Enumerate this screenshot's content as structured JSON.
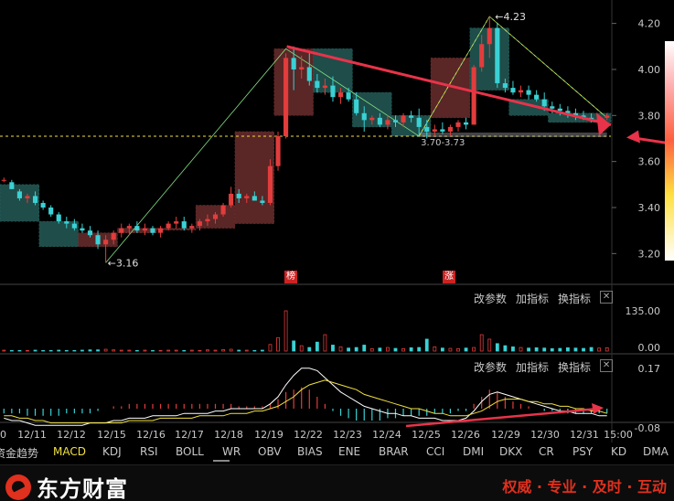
{
  "chart_data": {
    "type": "candlestick",
    "price_axis_ticks": [
      "4.20",
      "4.00",
      "3.80",
      "3.60",
      "3.40",
      "3.20"
    ],
    "price_range": [
      3.11,
      4.27
    ],
    "date_labels": [
      "0",
      "12/11",
      "12/12",
      "12/15",
      "12/16",
      "12/17",
      "12/18",
      "12/19",
      "12/22",
      "12/23",
      "12/24",
      "12/25",
      "12/26",
      "12/29",
      "12/30",
      "12/31",
      "15:00"
    ],
    "annotations": {
      "high": "4.23",
      "low": "3.16",
      "range": "3.70-3.73"
    },
    "badges": [
      "榜",
      "涨"
    ],
    "volume_axis_ticks": [
      "135.00",
      "0.00"
    ],
    "macd_axis_ticks": [
      "0.17",
      "-0.08"
    ],
    "candles": [
      [
        3.52,
        3.53,
        3.51,
        3.52
      ],
      [
        3.51,
        3.52,
        3.48,
        3.48
      ],
      [
        3.47,
        3.48,
        3.43,
        3.44
      ],
      [
        3.44,
        3.46,
        3.42,
        3.45
      ],
      [
        3.45,
        3.47,
        3.41,
        3.42
      ],
      [
        3.42,
        3.43,
        3.39,
        3.4
      ],
      [
        3.4,
        3.41,
        3.36,
        3.37
      ],
      [
        3.37,
        3.38,
        3.33,
        3.34
      ],
      [
        3.34,
        3.36,
        3.31,
        3.33
      ],
      [
        3.33,
        3.35,
        3.3,
        3.31
      ],
      [
        3.31,
        3.33,
        3.29,
        3.3
      ],
      [
        3.3,
        3.32,
        3.27,
        3.28
      ],
      [
        3.28,
        3.3,
        3.22,
        3.24
      ],
      [
        3.24,
        3.28,
        3.16,
        3.26
      ],
      [
        3.26,
        3.3,
        3.24,
        3.29
      ],
      [
        3.29,
        3.33,
        3.27,
        3.31
      ],
      [
        3.31,
        3.33,
        3.28,
        3.32
      ],
      [
        3.32,
        3.34,
        3.29,
        3.3
      ],
      [
        3.3,
        3.33,
        3.28,
        3.31
      ],
      [
        3.31,
        3.32,
        3.28,
        3.29
      ],
      [
        3.29,
        3.32,
        3.27,
        3.31
      ],
      [
        3.31,
        3.34,
        3.3,
        3.33
      ],
      [
        3.33,
        3.36,
        3.31,
        3.34
      ],
      [
        3.34,
        3.36,
        3.3,
        3.31
      ],
      [
        3.31,
        3.33,
        3.29,
        3.32
      ],
      [
        3.32,
        3.35,
        3.3,
        3.34
      ],
      [
        3.34,
        3.37,
        3.32,
        3.35
      ],
      [
        3.35,
        3.38,
        3.33,
        3.37
      ],
      [
        3.37,
        3.42,
        3.36,
        3.41
      ],
      [
        3.41,
        3.49,
        3.4,
        3.46
      ],
      [
        3.46,
        3.48,
        3.42,
        3.44
      ],
      [
        3.44,
        3.46,
        3.42,
        3.45
      ],
      [
        3.45,
        3.47,
        3.43,
        3.43
      ],
      [
        3.43,
        3.45,
        3.41,
        3.42
      ],
      [
        3.42,
        3.61,
        3.41,
        3.58
      ],
      [
        3.58,
        3.73,
        3.56,
        3.71
      ],
      [
        3.71,
        4.07,
        3.7,
        4.05
      ],
      [
        4.05,
        4.1,
        3.91,
        4.0
      ],
      [
        4.0,
        4.06,
        3.96,
        4.01
      ],
      [
        4.01,
        4.08,
        3.93,
        3.95
      ],
      [
        3.95,
        3.98,
        3.9,
        3.92
      ],
      [
        3.92,
        3.96,
        3.89,
        3.93
      ],
      [
        3.93,
        3.97,
        3.86,
        3.88
      ],
      [
        3.88,
        3.92,
        3.85,
        3.9
      ],
      [
        3.9,
        3.92,
        3.86,
        3.87
      ],
      [
        3.87,
        3.9,
        3.8,
        3.81
      ],
      [
        3.81,
        3.84,
        3.73,
        3.78
      ],
      [
        3.78,
        3.8,
        3.76,
        3.79
      ],
      [
        3.79,
        3.81,
        3.75,
        3.76
      ],
      [
        3.76,
        3.8,
        3.74,
        3.78
      ],
      [
        3.78,
        3.8,
        3.75,
        3.77
      ],
      [
        3.77,
        3.81,
        3.75,
        3.8
      ],
      [
        3.8,
        3.82,
        3.77,
        3.79
      ],
      [
        3.79,
        3.83,
        3.71,
        3.75
      ],
      [
        3.75,
        3.78,
        3.7,
        3.73
      ],
      [
        3.73,
        3.76,
        3.71,
        3.74
      ],
      [
        3.74,
        3.77,
        3.72,
        3.73
      ],
      [
        3.73,
        3.76,
        3.71,
        3.75
      ],
      [
        3.75,
        3.78,
        3.73,
        3.77
      ],
      [
        3.77,
        3.79,
        3.74,
        3.76
      ],
      [
        3.76,
        4.02,
        3.76,
        4.01
      ],
      [
        4.01,
        4.15,
        3.99,
        4.11
      ],
      [
        4.11,
        4.23,
        4.05,
        4.18
      ],
      [
        4.18,
        4.2,
        3.92,
        3.94
      ],
      [
        3.94,
        3.96,
        3.9,
        3.92
      ],
      [
        3.92,
        3.95,
        3.89,
        3.9
      ],
      [
        3.9,
        3.93,
        3.88,
        3.91
      ],
      [
        3.91,
        3.93,
        3.87,
        3.89
      ],
      [
        3.89,
        3.91,
        3.86,
        3.87
      ],
      [
        3.87,
        3.9,
        3.82,
        3.84
      ],
      [
        3.84,
        3.86,
        3.81,
        3.83
      ],
      [
        3.83,
        3.85,
        3.8,
        3.82
      ],
      [
        3.82,
        3.84,
        3.79,
        3.81
      ],
      [
        3.81,
        3.83,
        3.78,
        3.8
      ],
      [
        3.8,
        3.82,
        3.78,
        3.79
      ],
      [
        3.79,
        3.81,
        3.77,
        3.78
      ],
      [
        3.78,
        3.8,
        3.77,
        3.79
      ],
      [
        3.79,
        3.81,
        3.78,
        3.8
      ]
    ],
    "day_boxes": [
      {
        "from": 0,
        "to": 4,
        "open": 3.5,
        "close": 3.34,
        "up": false
      },
      {
        "from": 5,
        "to": 9,
        "open": 3.34,
        "close": 3.23,
        "up": false
      },
      {
        "from": 10,
        "to": 14,
        "open": 3.23,
        "close": 3.29,
        "up": true
      },
      {
        "from": 15,
        "to": 19,
        "open": 3.29,
        "close": 3.31,
        "up": true
      },
      {
        "from": 20,
        "to": 24,
        "open": 3.31,
        "close": 3.31,
        "up": true
      },
      {
        "from": 25,
        "to": 29,
        "open": 3.31,
        "close": 3.41,
        "up": true
      },
      {
        "from": 30,
        "to": 34,
        "open": 3.33,
        "close": 3.73,
        "up": true
      },
      {
        "from": 35,
        "to": 39,
        "open": 3.8,
        "close": 4.09,
        "up": true
      },
      {
        "from": 40,
        "to": 44,
        "open": 4.09,
        "close": 3.9,
        "up": false
      },
      {
        "from": 45,
        "to": 49,
        "open": 3.9,
        "close": 3.75,
        "up": false
      },
      {
        "from": 50,
        "to": 54,
        "open": 3.8,
        "close": 3.71,
        "up": false
      },
      {
        "from": 55,
        "to": 59,
        "open": 3.79,
        "close": 4.05,
        "up": true
      },
      {
        "from": 60,
        "to": 64,
        "open": 4.18,
        "close": 3.91,
        "up": false
      },
      {
        "from": 65,
        "to": 69,
        "open": 3.87,
        "close": 3.8,
        "up": false
      },
      {
        "from": 70,
        "to": 77,
        "open": 3.81,
        "close": 3.77,
        "up": false
      }
    ],
    "volume": [
      3,
      2,
      2,
      2,
      3,
      2,
      2,
      3,
      2,
      2,
      3,
      4,
      4,
      6,
      4,
      3,
      3,
      2,
      3,
      2,
      2,
      3,
      3,
      2,
      3,
      2,
      4,
      3,
      5,
      6,
      3,
      3,
      2,
      3,
      22,
      45,
      135,
      34,
      18,
      12,
      30,
      55,
      20,
      14,
      10,
      12,
      20,
      8,
      10,
      12,
      9,
      8,
      11,
      12,
      40,
      14,
      10,
      9,
      8,
      10,
      12,
      55,
      40,
      25,
      18,
      14,
      12,
      10,
      11,
      10,
      8,
      9,
      11,
      10,
      9,
      12,
      10,
      11
    ],
    "macd_hist": [
      -0.02,
      -0.02,
      -0.02,
      -0.03,
      -0.03,
      -0.03,
      -0.03,
      -0.03,
      -0.02,
      -0.02,
      -0.02,
      -0.02,
      -0.01,
      0.0,
      0.01,
      0.01,
      0.02,
      0.02,
      0.02,
      0.02,
      0.02,
      0.02,
      0.02,
      0.02,
      0.02,
      0.02,
      0.02,
      0.02,
      0.02,
      0.02,
      0.01,
      0.01,
      0.01,
      0.01,
      0.02,
      0.04,
      0.07,
      0.08,
      0.09,
      0.08,
      0.05,
      0.02,
      -0.01,
      -0.03,
      -0.04,
      -0.05,
      -0.05,
      -0.05,
      -0.05,
      -0.04,
      -0.04,
      -0.03,
      -0.03,
      -0.03,
      -0.03,
      -0.02,
      -0.02,
      -0.02,
      -0.01,
      -0.01,
      0.02,
      0.05,
      0.08,
      0.07,
      0.05,
      0.03,
      0.02,
      0.01,
      0.0,
      -0.01,
      -0.01,
      -0.02,
      -0.02,
      -0.02,
      -0.02,
      -0.02,
      -0.02,
      -0.02
    ],
    "macd_dif": [
      -0.04,
      -0.05,
      -0.05,
      -0.06,
      -0.07,
      -0.07,
      -0.07,
      -0.07,
      -0.07,
      -0.07,
      -0.07,
      -0.06,
      -0.06,
      -0.06,
      -0.05,
      -0.05,
      -0.04,
      -0.04,
      -0.04,
      -0.03,
      -0.03,
      -0.03,
      -0.03,
      -0.02,
      -0.02,
      -0.02,
      -0.02,
      -0.01,
      -0.01,
      0.0,
      0.0,
      0.0,
      0.0,
      0.0,
      0.02,
      0.05,
      0.1,
      0.14,
      0.17,
      0.17,
      0.16,
      0.13,
      0.1,
      0.07,
      0.05,
      0.03,
      0.01,
      0.0,
      -0.01,
      -0.02,
      -0.02,
      -0.03,
      -0.03,
      -0.04,
      -0.04,
      -0.04,
      -0.05,
      -0.05,
      -0.05,
      -0.04,
      -0.01,
      0.03,
      0.06,
      0.07,
      0.06,
      0.05,
      0.04,
      0.03,
      0.02,
      0.01,
      0.0,
      -0.01,
      -0.01,
      -0.02,
      -0.02,
      -0.02,
      -0.03,
      -0.03
    ],
    "macd_dea": [
      -0.03,
      -0.03,
      -0.04,
      -0.04,
      -0.05,
      -0.05,
      -0.06,
      -0.06,
      -0.06,
      -0.06,
      -0.06,
      -0.06,
      -0.06,
      -0.06,
      -0.06,
      -0.06,
      -0.05,
      -0.05,
      -0.05,
      -0.05,
      -0.04,
      -0.04,
      -0.04,
      -0.04,
      -0.04,
      -0.03,
      -0.03,
      -0.03,
      -0.03,
      -0.02,
      -0.02,
      -0.02,
      -0.01,
      -0.01,
      0.0,
      0.01,
      0.03,
      0.05,
      0.08,
      0.1,
      0.11,
      0.12,
      0.11,
      0.1,
      0.09,
      0.08,
      0.06,
      0.05,
      0.04,
      0.03,
      0.02,
      0.01,
      0.0,
      0.0,
      -0.01,
      -0.02,
      -0.02,
      -0.03,
      -0.03,
      -0.03,
      -0.02,
      -0.01,
      0.01,
      0.03,
      0.04,
      0.04,
      0.04,
      0.03,
      0.03,
      0.02,
      0.02,
      0.01,
      0.01,
      0.0,
      0.0,
      -0.01,
      -0.01,
      -0.02
    ]
  },
  "panels": {
    "volume": {
      "tools": [
        "改参数",
        "加指标",
        "换指标"
      ]
    },
    "macd": {
      "tools": [
        "改参数",
        "加指标",
        "换指标"
      ]
    }
  },
  "close_icon": "✕",
  "tabs": {
    "items": [
      "资金趋势",
      "MACD",
      "KDJ",
      "RSI",
      "BOLL",
      "WR",
      "OBV",
      "BIAS",
      "ENE",
      "BRAR",
      "CCI",
      "DMI",
      "DKX",
      "CR",
      "PSY",
      "KD",
      "DMA"
    ],
    "active": "MACD"
  },
  "footer": {
    "logo_text": "东方财富",
    "slogan": "权威 · 专业 · 及时 · 互动"
  },
  "colors": {
    "up": "#e23c3c",
    "down": "#3ad1d4",
    "up_box": "#5a2626",
    "down_box": "#1f4d4a",
    "arrow": "#e8334a",
    "dashed": "#f0e040",
    "dif": "#ffffff",
    "dea": "#f0e040"
  }
}
